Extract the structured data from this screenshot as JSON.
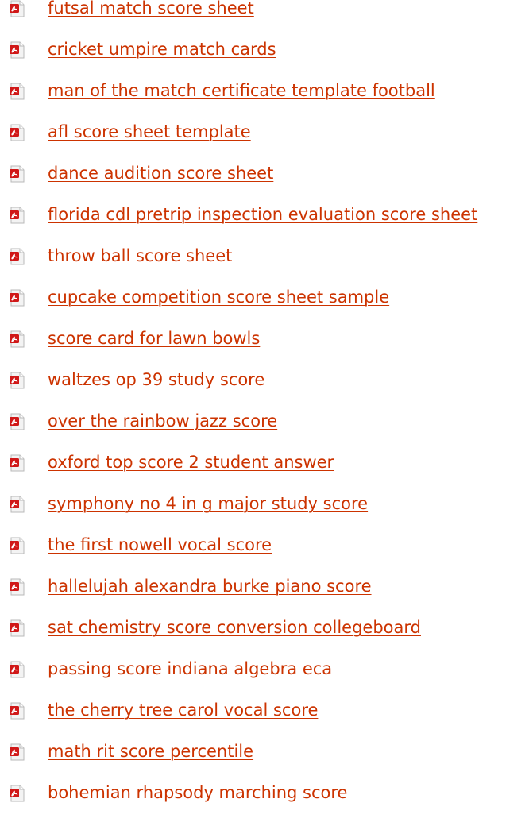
{
  "colors": {
    "link": "#cc3300",
    "icon_page": "#f3f3f3",
    "icon_border": "#b8b8b8",
    "icon_badge": "#d01818"
  },
  "icon": "pdf-document-icon",
  "links": [
    "futsal match score sheet",
    "cricket umpire match cards",
    "man of the match certificate template football",
    "afl score sheet template",
    "dance audition score sheet",
    "florida cdl pretrip inspection evaluation score sheet",
    "throw ball score sheet",
    "cupcake competition score sheet sample",
    "score card for lawn bowls",
    "waltzes op 39 study score",
    "over the rainbow jazz score",
    "oxford top score 2 student answer",
    "symphony no 4 in g major study score",
    "the first nowell vocal score",
    "hallelujah alexandra burke piano score",
    "sat chemistry score conversion collegeboard",
    "passing score indiana algebra eca",
    "the cherry tree carol vocal score",
    "math rit score percentile",
    "bohemian rhapsody marching score"
  ]
}
